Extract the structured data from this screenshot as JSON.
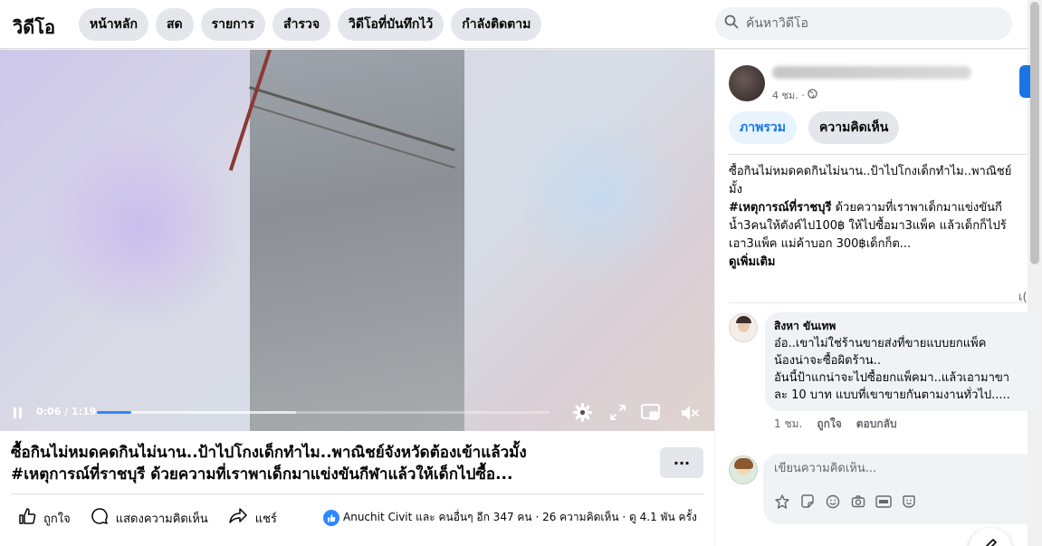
{
  "header": {
    "title": "วิดีโอ",
    "tabs": [
      {
        "label": "หน้าหลัก"
      },
      {
        "label": "สด"
      },
      {
        "label": "รายการ"
      },
      {
        "label": "สำรวจ"
      },
      {
        "label": "วิดีโอที่บันทึกไว้"
      },
      {
        "label": "กำลังติดตาม"
      }
    ],
    "search": {
      "placeholder": "ค้นหาวิดีโอ",
      "icon": "search-icon"
    }
  },
  "player": {
    "time": "0:06 / 1:19",
    "progress": 0.076,
    "icons": [
      "pause-icon",
      "gear-icon",
      "fullscreen-icon",
      "miniplayer-icon",
      "volume-muted-icon"
    ]
  },
  "post": {
    "title_line1": "ซื้อกินไม่หมดคดกินไม่นาน..ป้าไปโกงเด็กทำไม..พาณิชย์จังหวัดต้องเข้าแล้วมั้ง",
    "title_line2": "#เหตุการณ์ที่ราชบุรี ด้วยความที่เราพาเด็กมาแข่งขันกีฬาแล้วให้เด็กไปซื้อ...",
    "more_label": "···",
    "actions": {
      "like": "ถูกใจ",
      "comment": "แสดงความคิดเห็น",
      "share": "แชร์"
    },
    "stats": "Anuchit Civit และ คนอื่นๆ อีก 347 คน · 26 ความคิดเห็น · ดู 4.1 พัน ครั้ง"
  },
  "sidebar": {
    "meta": "4 ชม. ·",
    "segments": {
      "overview": "ภาพรวม",
      "comments": "ความคิดเห็น"
    },
    "description": {
      "line1": "ซื้อกินไม่หมดคดกินไม่นาน..ป้าไปโกงเด็กทำไม..พาณิชย์",
      "line2": "มั้ง",
      "hashtag": "#เหตุการณ์ที่ราชบุรี",
      "line3_rest": " ด้วยความที่เราพาเด็กมาแข่งขันกี",
      "line4": "น้ำ3คนให้ตังค์ไป100฿ ให้ไปซื้อมา3แพ็ค แล้วเด็กก็ไปร้",
      "line5": "เอา3แพ็ค แม่ค้าบอก 300฿เด็กก็ต...",
      "see_more": "ดูเพิ่มเติม"
    },
    "sort_label": "เ(",
    "comment": {
      "name": "สิงหา ขันเทพ",
      "lines": [
        "อ๋อ..เขาไม่ใช่ร้านขายส่งที่ขายแบบยกแพ็ค",
        "น้องน่าจะซื้อผิดร้าน..",
        "อันนี้ป้าแกน่าจะไปซื้อยกแพ็คมา..แล้วเอามาขา",
        "ละ 10 บาท แบบที่เขาขายกันตามงานทั่วไป....."
      ],
      "time": "1 ชม.",
      "like": "ถูกใจ",
      "reply": "ตอบกลับ"
    },
    "composer": {
      "placeholder": "เขียนความคิดเห็น...",
      "tools": [
        "avatar-sticker-icon",
        "sticker-icon",
        "emoji-icon",
        "camera-icon",
        "gif-icon",
        "sticker-face-icon"
      ]
    }
  }
}
